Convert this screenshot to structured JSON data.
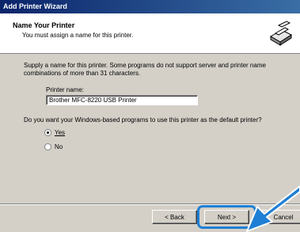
{
  "window": {
    "title": "Add Printer Wizard"
  },
  "header": {
    "title": "Name Your Printer",
    "subtitle": "You must assign a name for this printer."
  },
  "main": {
    "description": "Supply a name for this printer. Some programs do not support server and printer name combinations of more than 31 characters.",
    "printer_name_label": "Printer name:",
    "printer_name_value": "Brother MFC-8220 USB Printer",
    "default_question": "Do you want your Windows-based programs to use this printer as the default printer?",
    "options": [
      {
        "label": "Yes",
        "checked": true
      },
      {
        "label": "No",
        "checked": false
      }
    ]
  },
  "buttons": {
    "back": "< Back",
    "next": "Next >",
    "cancel": "Cancel"
  },
  "colors": {
    "highlight": "#1f7fd4",
    "arrow": "#1f7fd4",
    "titlebar": "#0a246a"
  }
}
